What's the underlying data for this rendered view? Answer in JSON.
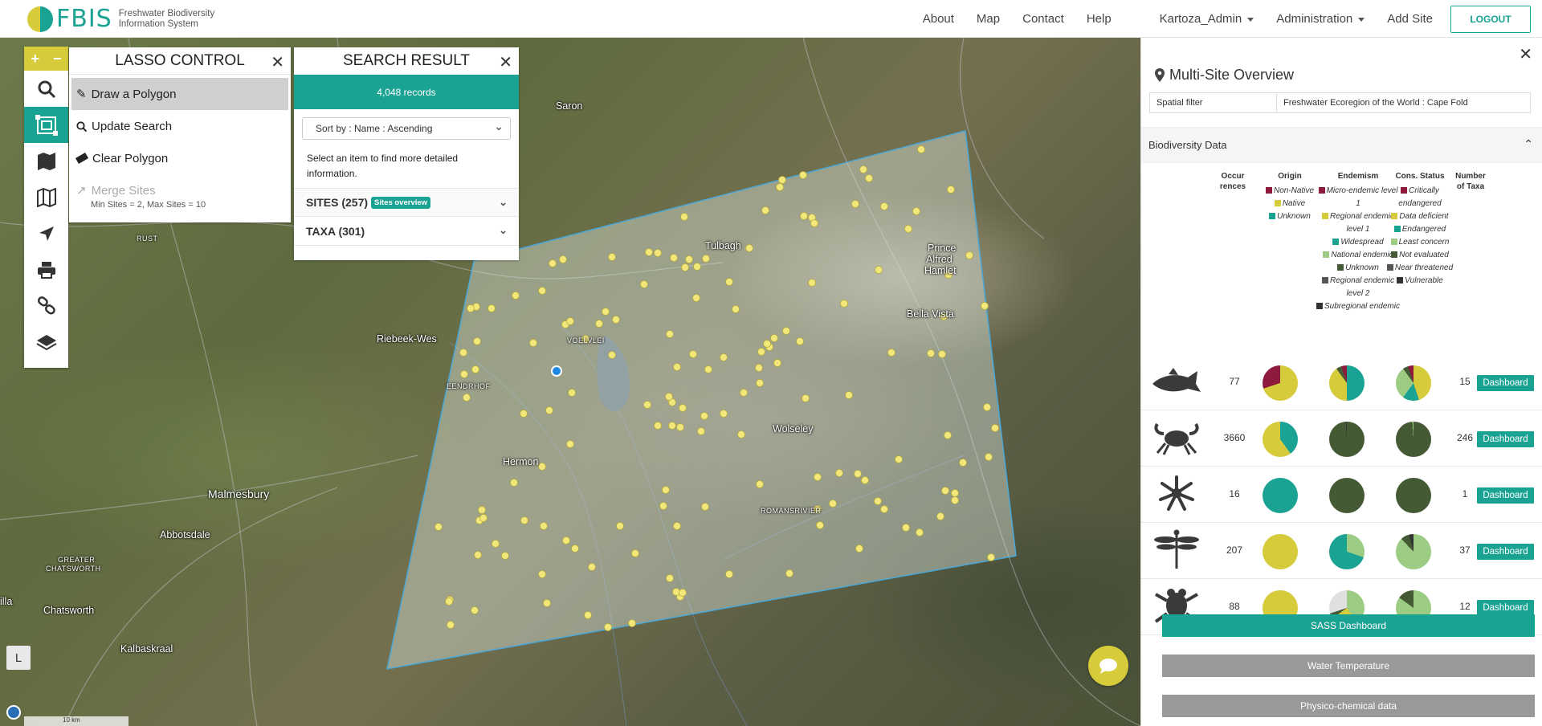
{
  "header": {
    "logo_text": "FBIS",
    "logo_subtitle_1": "Freshwater Biodiversity",
    "logo_subtitle_2": "Information System",
    "nav": [
      "About",
      "Map",
      "Contact",
      "Help"
    ],
    "user_menu": "Kartoza_Admin",
    "admin_menu": "Administration",
    "add_site": "Add Site",
    "logout": "LOGOUT"
  },
  "toolbar": {
    "zoom_in": "+",
    "zoom_out": "−",
    "icons": [
      "search-icon",
      "lasso-icon",
      "map-book-icon",
      "map-icon",
      "locate-arrow-icon",
      "print-icon",
      "link-icon",
      "layers-icon"
    ]
  },
  "lasso": {
    "title": "LASSO CONTROL",
    "draw": "Draw a Polygon",
    "update": "Update Search",
    "clear": "Clear Polygon",
    "merge": "Merge Sites",
    "merge_note": "Min Sites = 2, Max Sites = 10"
  },
  "search": {
    "title": "SEARCH RESULT",
    "records": "4,048 records",
    "sort": "Sort by : Name : Ascending",
    "hint": "Select an item to find more detailed information.",
    "sites": "SITES (257)",
    "sites_badge": "Sites overview",
    "taxa": "TAXA (301)"
  },
  "map": {
    "places": [
      {
        "name": "Saron"
      },
      {
        "name": "Tulbagh"
      },
      {
        "name": "Prince"
      },
      {
        "name": "Alfred"
      },
      {
        "name": "Hamlet"
      },
      {
        "name": "Bella Vista"
      },
      {
        "name": "Riebeek-Wes"
      },
      {
        "name": "VOELVLEI"
      },
      {
        "name": "EENDRHOF"
      },
      {
        "name": "Hermon"
      },
      {
        "name": "Wolseley"
      },
      {
        "name": "ROMANSRIVIER"
      },
      {
        "name": "Malmesbury"
      },
      {
        "name": "Abbotsdale"
      },
      {
        "name": "GREATER"
      },
      {
        "name": "CHATSWORTH"
      },
      {
        "name": "Chatsworth"
      },
      {
        "name": "Kalbaskraal"
      },
      {
        "name": "RUST"
      },
      {
        "name": "illa"
      }
    ],
    "layer_button": "L",
    "scale": "10 km"
  },
  "panel": {
    "title": "Multi-Site Overview",
    "spatial_filter_key": "Spatial filter",
    "spatial_filter_value": "Freshwater Ecoregion of the World : Cape Fold",
    "section": "Biodiversity Data",
    "col_occ_1": "Occur",
    "col_occ_2": "rences",
    "col_origin": "Origin",
    "col_endemism": "Endemism",
    "col_cons": "Cons. Status",
    "col_taxa_1": "Number",
    "col_taxa_2": "of Taxa",
    "legend_origin": [
      {
        "label": "Non-Native",
        "color": "#8e1b3e"
      },
      {
        "label": "Native",
        "color": "#d6cb3a"
      },
      {
        "label": "Unknown",
        "color": "#1aa292"
      }
    ],
    "legend_endemism": [
      {
        "label": "Micro-endemic level 1",
        "color": "#8e1b3e"
      },
      {
        "label": "Regional endemic level 1",
        "color": "#d6cb3a"
      },
      {
        "label": "Widespread",
        "color": "#1aa292"
      },
      {
        "label": "National endemic",
        "color": "#9ccc84"
      },
      {
        "label": "Unknown",
        "color": "#445a35"
      },
      {
        "label": "Regional endemic level 2",
        "color": "#555555"
      },
      {
        "label": "Subregional endemic",
        "color": "#333333"
      }
    ],
    "legend_cons": [
      {
        "label": "Critically endangered",
        "color": "#8e1b3e"
      },
      {
        "label": "Data deficient",
        "color": "#d6cb3a"
      },
      {
        "label": "Endangered",
        "color": "#1aa292"
      },
      {
        "label": "Least concern",
        "color": "#9ccc84"
      },
      {
        "label": "Not evaluated",
        "color": "#445a35"
      },
      {
        "label": "Near threatened",
        "color": "#555555"
      },
      {
        "label": "Vulnerable",
        "color": "#333333"
      }
    ],
    "rows": [
      {
        "icon": "fish-icon",
        "occurrences": "77",
        "taxa": "15",
        "dashboard": "Dashboard",
        "origin": [
          {
            "c": "#d6cb3a",
            "p": 70
          },
          {
            "c": "#8e1b3e",
            "p": 30
          }
        ],
        "endemism": [
          {
            "c": "#1aa292",
            "p": 50
          },
          {
            "c": "#d6cb3a",
            "p": 40
          },
          {
            "c": "#445a35",
            "p": 5
          },
          {
            "c": "#8e1b3e",
            "p": 5
          }
        ],
        "cons": [
          {
            "c": "#d6cb3a",
            "p": 45
          },
          {
            "c": "#1aa292",
            "p": 15
          },
          {
            "c": "#9ccc84",
            "p": 30
          },
          {
            "c": "#445a35",
            "p": 5
          },
          {
            "c": "#8e1b3e",
            "p": 5
          }
        ]
      },
      {
        "icon": "crab-icon",
        "occurrences": "3660",
        "taxa": "246",
        "dashboard": "Dashboard",
        "origin": [
          {
            "c": "#1aa292",
            "p": 40
          },
          {
            "c": "#d6cb3a",
            "p": 60
          }
        ],
        "endemism": [
          {
            "c": "#445a35",
            "p": 99
          },
          {
            "c": "#333333",
            "p": 1
          }
        ],
        "cons": [
          {
            "c": "#445a35",
            "p": 99
          },
          {
            "c": "#9ccc84",
            "p": 1
          }
        ]
      },
      {
        "icon": "sponge-icon",
        "occurrences": "16",
        "taxa": "1",
        "dashboard": "Dashboard",
        "origin": [
          {
            "c": "#1aa292",
            "p": 100
          }
        ],
        "endemism": [
          {
            "c": "#445a35",
            "p": 100
          }
        ],
        "cons": [
          {
            "c": "#445a35",
            "p": 100
          }
        ]
      },
      {
        "icon": "dragonfly-icon",
        "occurrences": "207",
        "taxa": "37",
        "dashboard": "Dashboard",
        "origin": [
          {
            "c": "#d6cb3a",
            "p": 100
          }
        ],
        "endemism": [
          {
            "c": "#9ccc84",
            "p": 30
          },
          {
            "c": "#1aa292",
            "p": 70
          }
        ],
        "cons": [
          {
            "c": "#9ccc84",
            "p": 88
          },
          {
            "c": "#445a35",
            "p": 8
          },
          {
            "c": "#333333",
            "p": 4
          }
        ]
      },
      {
        "icon": "frog-icon",
        "occurrences": "88",
        "taxa": "12",
        "dashboard": "Dashboard",
        "origin": [
          {
            "c": "#d6cb3a",
            "p": 100
          }
        ],
        "endemism": [
          {
            "c": "#9ccc84",
            "p": 40
          },
          {
            "c": "#d6cb3a",
            "p": 25
          },
          {
            "c": "#445a35",
            "p": 5
          },
          {
            "c": "#e0e0e0",
            "p": 30
          }
        ],
        "cons": [
          {
            "c": "#9ccc84",
            "p": 85
          },
          {
            "c": "#445a35",
            "p": 15
          }
        ]
      }
    ],
    "sass_button": "SASS Dashboard",
    "water_temp_button": "Water Temperature",
    "physico_button": "Physico-chemical data"
  }
}
